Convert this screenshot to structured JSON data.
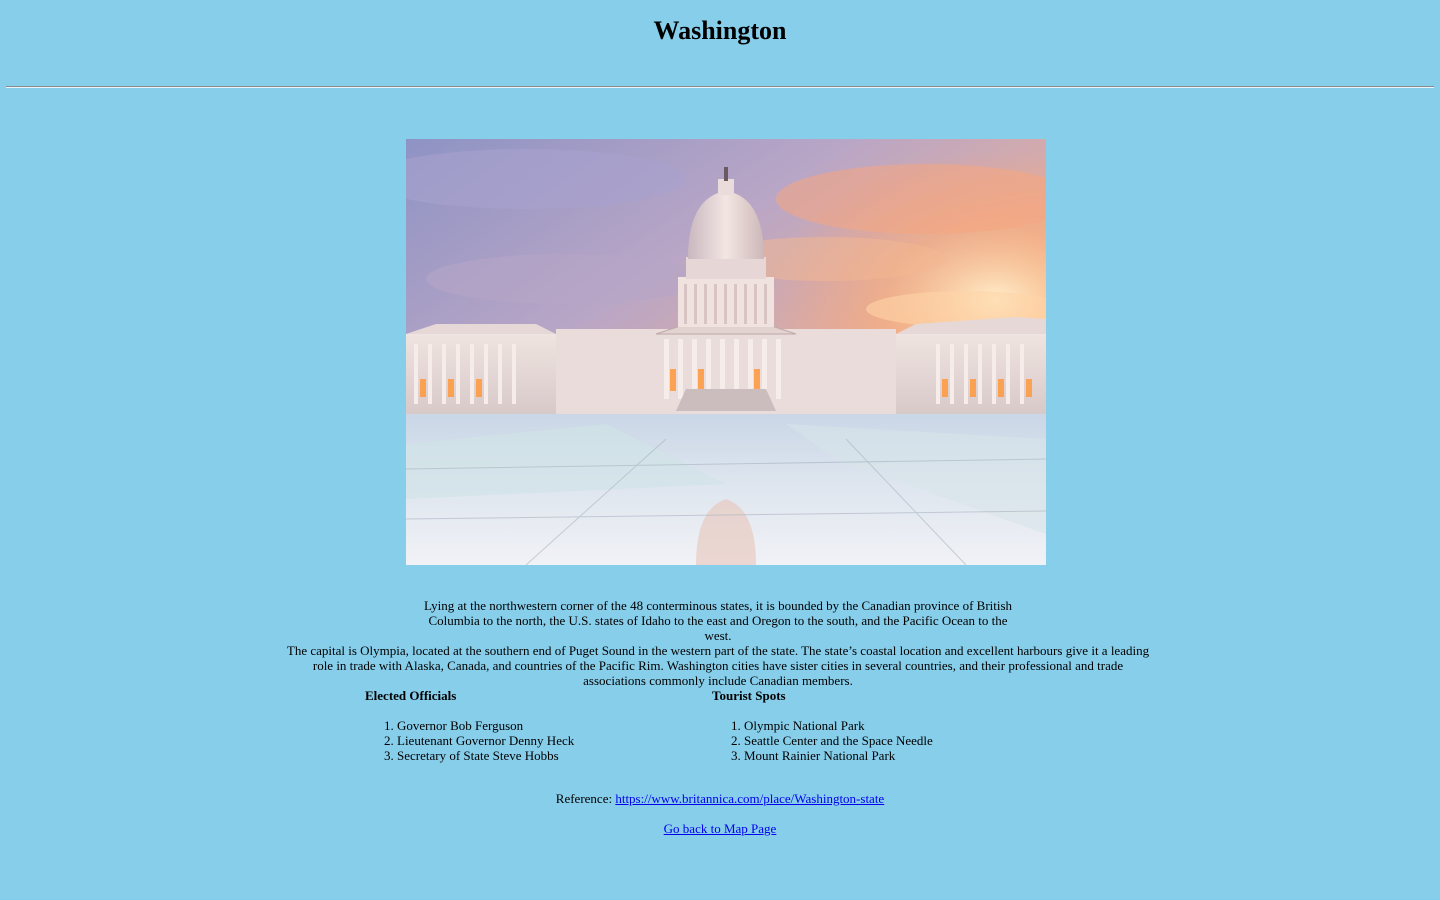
{
  "page": {
    "title": "Washington"
  },
  "image": {
    "alt": "United States Capitol building at sunset reflected in a glass plaza"
  },
  "description": {
    "paragraph1": "Lying at the northwestern corner of the 48 conterminous states, it is bounded by the Canadian province of British Columbia to the north, the U.S. states of Idaho to the east and Oregon to the south, and the Pacific Ocean to the west.",
    "paragraph2": "The capital is Olympia, located at the southern end of Puget Sound in the western part of the state. The state’s coastal location and excellent harbours give it a leading role in trade with Alaska, Canada, and countries of the Pacific Rim. Washington cities have sister cities in several countries, and their professional and trade associations commonly include Canadian members."
  },
  "officials": {
    "heading": "Elected Officials",
    "items": [
      "Governor Bob Ferguson",
      "Lieutenant Governor Denny Heck",
      "Secretary of State Steve Hobbs"
    ]
  },
  "tourist": {
    "heading": "Tourist Spots",
    "items": [
      "Olympic National Park",
      "Seattle Center and the Space Needle",
      "Mount Rainier National Park"
    ]
  },
  "reference": {
    "label": "Reference: ",
    "link_text": "https://www.britannica.com/place/Washington-state"
  },
  "navigation": {
    "back_link": "Go back to Map Page"
  },
  "colors": {
    "background": "#87CEEB",
    "link": "#0000EE"
  }
}
